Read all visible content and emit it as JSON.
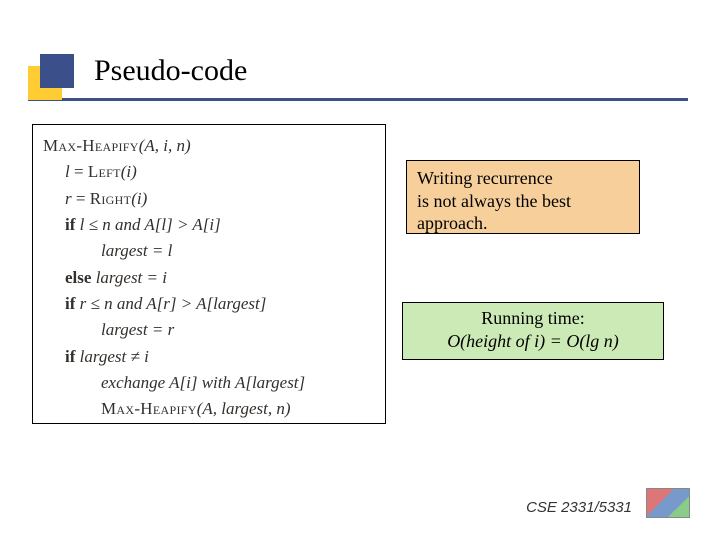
{
  "title": "Pseudo-code",
  "pseudocode": {
    "header_fn": "Max-Heapify",
    "header_args": "(A, i, n)",
    "l1_lhs": "l",
    "l1_eq": " = ",
    "l1_fn": "Left",
    "l1_args": "(i)",
    "l2_lhs": "r",
    "l2_eq": " = ",
    "l2_fn": "Right",
    "l2_args": "(i)",
    "if_kw": "if",
    "l3_cond": " l ≤ n and A[l] > A[i]",
    "l4": "largest = l",
    "else_kw": "else",
    "l5_rest": " largest = i",
    "l6_cond": " r ≤ n and A[r] > A[largest]",
    "l7": "largest = r",
    "l8_cond": " largest ≠ i",
    "l9": "exchange A[i] with A[largest]",
    "l10_fn": "Max-Heapify",
    "l10_args": "(A, largest, n)"
  },
  "callout_orange": {
    "line1": "Writing recurrence",
    "line2": "is not always the best",
    "line3": "approach."
  },
  "callout_green": {
    "line1": "Running time:",
    "line2": "O(height of i) = O(lg n)"
  },
  "footer": "CSE 2331/5331"
}
